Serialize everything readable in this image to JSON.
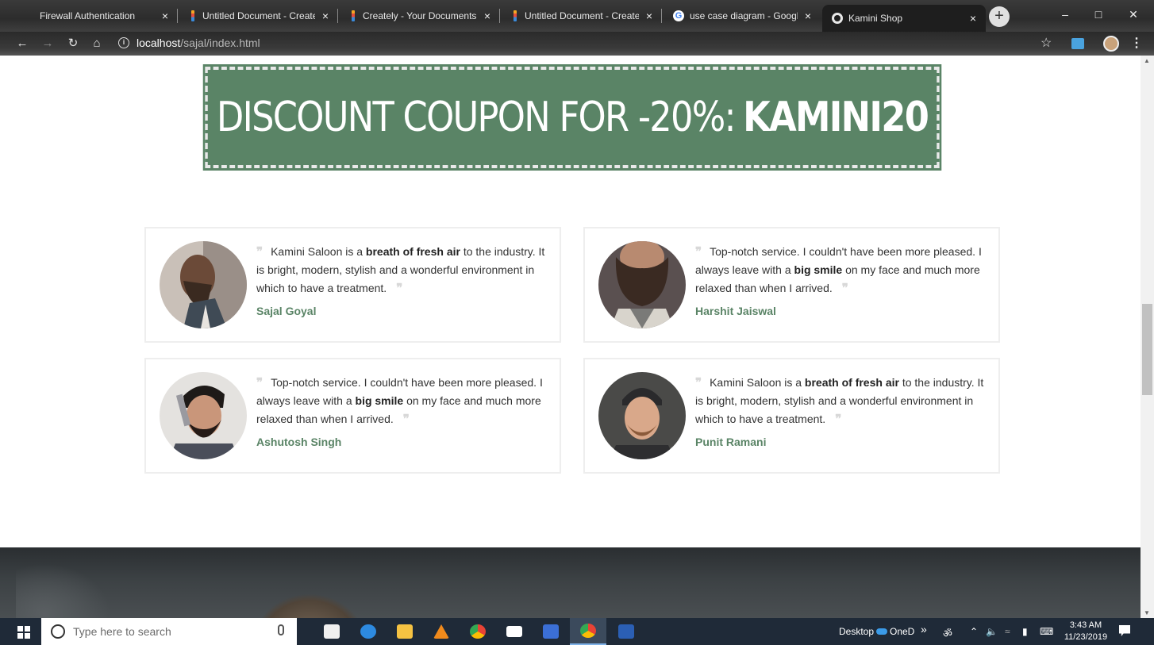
{
  "browser": {
    "tabs": [
      {
        "title": "Firewall Authentication",
        "favicon": "blank"
      },
      {
        "title": "Untitled Document - Creately",
        "favicon": "creately"
      },
      {
        "title": "Creately - Your Documents",
        "favicon": "creately"
      },
      {
        "title": "Untitled Document - Creately",
        "favicon": "creately"
      },
      {
        "title": "use case diagram - Google S",
        "favicon": "google"
      },
      {
        "title": "Kamini Shop",
        "favicon": "globe"
      }
    ],
    "close_glyph": "×",
    "new_tab_glyph": "+",
    "url_host": "localhost",
    "url_path": "/sajal/index.html",
    "info_glyph": "i"
  },
  "page": {
    "coupon": {
      "prefix": "DISCOUNT COUPON FOR -20%:",
      "code": "KAMINI20",
      "bg_color": "#5a8466"
    },
    "testimonials": [
      {
        "before": "Kamini Saloon is a ",
        "bold": "breath of fresh air",
        "after": " to the industry. It is bright, modern, stylish and a wonderful environment in which to have a treatment.",
        "author": "Sajal Goyal"
      },
      {
        "before": "Top-notch service. I couldn't have been more pleased. I always leave with a ",
        "bold": "big smile",
        "after": " on my face and much more relaxed than when I arrived.",
        "author": "Harshit Jaiswal"
      },
      {
        "before": "Top-notch service. I couldn't have been more pleased. I always leave with a ",
        "bold": "big smile",
        "after": " on my face and much more relaxed than when I arrived.",
        "author": "Ashutosh Singh"
      },
      {
        "before": "Kamini Saloon is a ",
        "bold": "breath of fresh air",
        "after": " to the industry. It is bright, modern, stylish and a wonderful environment in which to have a treatment.",
        "author": "Punit Ramani"
      }
    ],
    "quote_glyph": "❞",
    "accent_color": "#5a8466"
  },
  "taskbar": {
    "search_placeholder": "Type here to search",
    "desktop_label": "Desktop",
    "onedrive_label": "OneD",
    "chevron": "»",
    "time": "3:43 AM",
    "date": "11/23/2019"
  }
}
